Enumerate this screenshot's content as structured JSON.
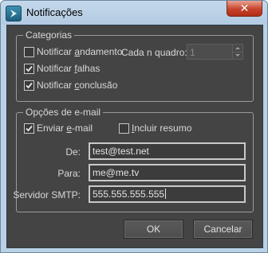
{
  "window": {
    "title": "Notificações",
    "close_label": "✕",
    "icon": "3ds-max-icon"
  },
  "categorias": {
    "group_label": "Categorias",
    "notificar_andamento": {
      "label_before": "Notificar ",
      "mnemonic": "a",
      "label_after": "ndamento",
      "checked": false
    },
    "cada_n_quadro": {
      "label": "Cada n quadro:",
      "value": "1"
    },
    "notificar_falhas": {
      "label_before": "Notificar ",
      "mnemonic": "f",
      "label_after": "alhas",
      "checked": true
    },
    "notificar_conclusao": {
      "label_before": "Notificar ",
      "mnemonic": "c",
      "label_after": "onclusão",
      "checked": true
    }
  },
  "email": {
    "group_label": "Opções de e-mail",
    "enviar_email": {
      "label_before": "Enviar ",
      "mnemonic": "e",
      "label_after": "-mail",
      "checked": true
    },
    "incluir_resumo": {
      "label_before": "",
      "mnemonic": "I",
      "label_after": "ncluir resumo",
      "checked": false
    },
    "de": {
      "label": "De:",
      "value": "test@test.net"
    },
    "para": {
      "label": "Para:",
      "value": "me@me.tv"
    },
    "smtp": {
      "label": "Servidor SMTP:",
      "value": "555.555.555.555"
    }
  },
  "buttons": {
    "ok_label": "OK",
    "cancel_label": "Cancelar"
  },
  "colors": {
    "client_bg": "#444444",
    "frame": "#b9d1e6",
    "close": "#c7432b"
  }
}
